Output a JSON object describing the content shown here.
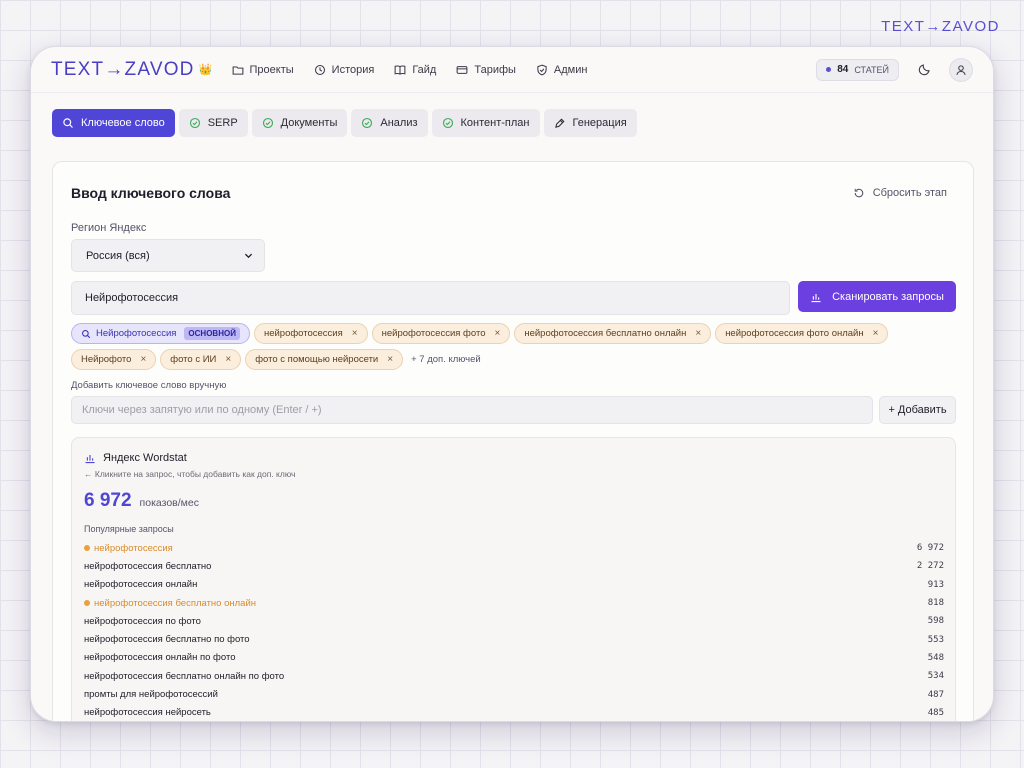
{
  "corner_logo": "TEXT→ZAVOD",
  "brand": {
    "name": "TEXT→ZAVOD",
    "crown": "👑"
  },
  "nav": [
    {
      "label": "Проекты",
      "icon": "folder-icon"
    },
    {
      "label": "История",
      "icon": "history-icon"
    },
    {
      "label": "Гайд",
      "icon": "book-icon"
    },
    {
      "label": "Тарифы",
      "icon": "card-icon"
    },
    {
      "label": "Админ",
      "icon": "shield-icon"
    }
  ],
  "credits": {
    "count": "84",
    "unit": "СТАТЕЙ",
    "accent": "#5b4fd1"
  },
  "steps": [
    {
      "label": "Ключевое слово",
      "icon": "search-icon",
      "active": true
    },
    {
      "label": "SERP",
      "icon": "check-circle-icon",
      "active": false
    },
    {
      "label": "Документы",
      "icon": "check-circle-icon",
      "active": false
    },
    {
      "label": "Анализ",
      "icon": "check-circle-icon",
      "active": false
    },
    {
      "label": "Контент-план",
      "icon": "check-circle-icon",
      "active": false
    },
    {
      "label": "Генерация",
      "icon": "pen-icon",
      "active": false
    }
  ],
  "card": {
    "title": "Ввод ключевого слова",
    "reset_label": "Сбросить этап",
    "region_label": "Регион Яндекс",
    "region_value": "Россия (вся)",
    "keyword_value": "Нейрофотосессия",
    "scan_label": "Сканировать запросы"
  },
  "chips": {
    "main": {
      "label": "Нейрофотосессия",
      "badge": "ОСНОВНОЙ"
    },
    "extra": [
      "нейрофотосессия",
      "нейрофотосессия фото",
      "нейрофотосессия бесплатно онлайн",
      "нейрофотосессия фото онлайн",
      "Нейрофото",
      "фото с ИИ",
      "фото с помощью нейросети"
    ],
    "more": "+ 7 доп. ключей",
    "remove_glyph": "×"
  },
  "manual": {
    "label": "Добавить ключевое слово вручную",
    "placeholder": "Ключи через запятую или по одному (Enter / +)",
    "add_label": "+ Добавить"
  },
  "wordstat": {
    "title": "Яндекс Wordstat",
    "hint": "← Кликните на запрос, чтобы добавить как доп. ключ",
    "total": "6 972",
    "total_unit": "показов/мес",
    "popular_label": "Популярные запросы",
    "rows": [
      {
        "query": "нейрофотосессия",
        "count": "6 972",
        "highlight": true
      },
      {
        "query": "нейрофотосессия бесплатно",
        "count": "2 272",
        "highlight": false
      },
      {
        "query": "нейрофотосессия онлайн",
        "count": "913",
        "highlight": false
      },
      {
        "query": "нейрофотосессия бесплатно онлайн",
        "count": "818",
        "highlight": true
      },
      {
        "query": "нейрофотосессия по фото",
        "count": "598",
        "highlight": false
      },
      {
        "query": "нейрофотосессия бесплатно по фото",
        "count": "553",
        "highlight": false
      },
      {
        "query": "нейрофотосессия онлайн по фото",
        "count": "548",
        "highlight": false
      },
      {
        "query": "нейрофотосессия бесплатно онлайн по фото",
        "count": "534",
        "highlight": false
      },
      {
        "query": "промты для нейрофотосессий",
        "count": "487",
        "highlight": false
      },
      {
        "query": "нейрофотосессия нейросеть",
        "count": "485",
        "highlight": false
      }
    ]
  },
  "colors": {
    "primary": "#4f46d8",
    "scan": "#6b3fe0",
    "chip": "#fbeedd",
    "highlight": "#d98b2a"
  }
}
